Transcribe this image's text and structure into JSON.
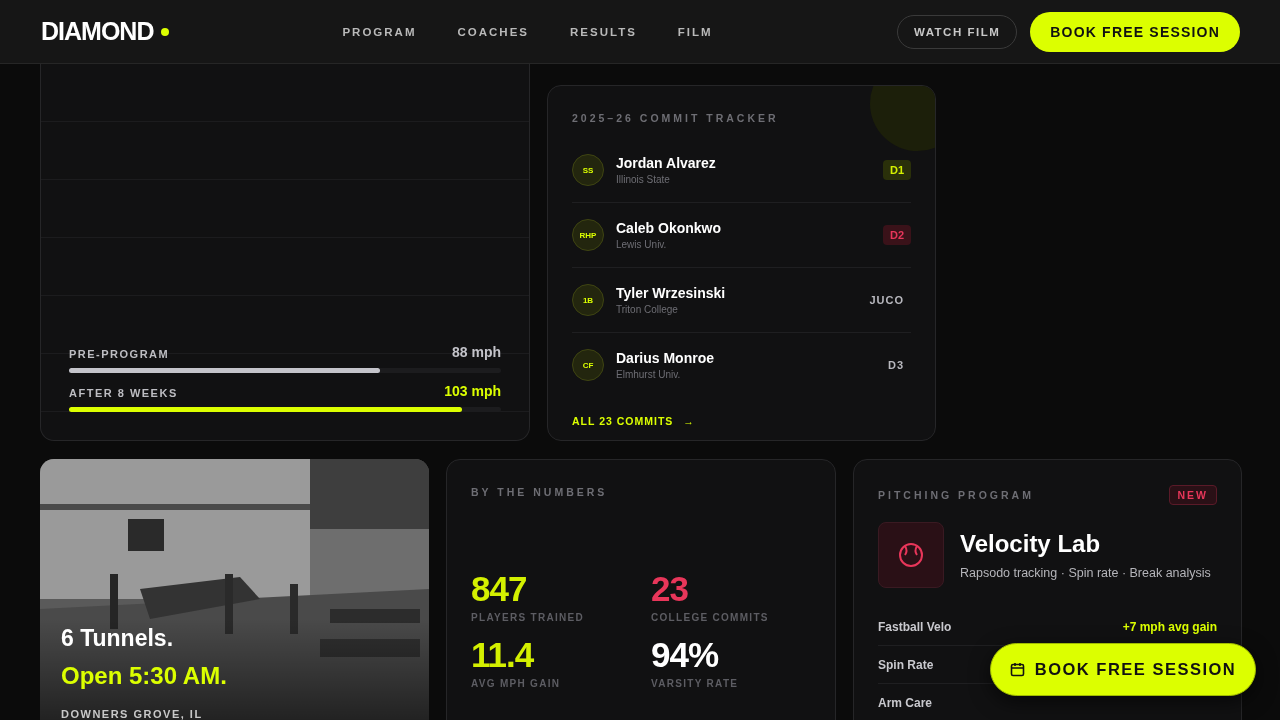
{
  "header": {
    "logo": "DIAMOND",
    "nav": [
      {
        "label": "PROGRAM"
      },
      {
        "label": "COACHES"
      },
      {
        "label": "RESULTS"
      },
      {
        "label": "FILM"
      }
    ],
    "secondary_button": "WATCH FILM",
    "primary_button": "BOOK FREE SESSION"
  },
  "velocity": {
    "bars": [
      {
        "label": "PRE-PROGRAM",
        "reading": "88 mph",
        "level": 0.72,
        "kind": "base"
      },
      {
        "label": "AFTER 8 WEEKS",
        "reading": "103 mph",
        "level": 0.91,
        "kind": "accent"
      }
    ]
  },
  "commits": {
    "title": "2025–26 COMMIT TRACKER",
    "players": [
      {
        "position": "SS",
        "name": "Jordan Alvarez",
        "school": "Illinois State",
        "division": "D1",
        "kind": "accent"
      },
      {
        "position": "RHP",
        "name": "Caleb Okonkwo",
        "school": "Lewis Univ.",
        "division": "D2",
        "kind": "alert"
      },
      {
        "position": "1B",
        "name": "Tyler Wrzesinski",
        "school": "Triton College",
        "division": "JUCO",
        "kind": "plain"
      },
      {
        "position": "CF",
        "name": "Darius Monroe",
        "school": "Elmhurst Univ.",
        "division": "D3",
        "kind": "plain"
      }
    ],
    "link": "ALL 23 COMMITS",
    "link_arrow": "→"
  },
  "facility": {
    "kind": "picture",
    "headline": "6 Tunnels.",
    "subline": "Open 5:30 AM.",
    "location": "DOWNERS GROVE, IL"
  },
  "numbers": {
    "title": "BY THE NUMBERS",
    "stats": [
      {
        "value": "847",
        "label": "PLAYERS TRAINED",
        "color": "#d4f000"
      },
      {
        "value": "23",
        "label": "COLLEGE COMMITS",
        "color": "#e8365a"
      },
      {
        "value": "11.4",
        "label": "AVG MPH GAIN",
        "color": "#d4f000"
      },
      {
        "value": "94%",
        "label": "VARSITY RATE",
        "color": "#ffffff"
      }
    ]
  },
  "pitching": {
    "title": "PITCHING PROGRAM",
    "badge": "NEW",
    "name": "Velocity Lab",
    "description": "Rapsodo tracking · Spin rate · Break analysis",
    "rows": [
      {
        "label": "Fastball Velo",
        "value": "+7 mph avg gain"
      },
      {
        "label": "Spin Rate"
      },
      {
        "label": "Arm Care"
      }
    ]
  },
  "floating_button": "BOOK FREE SESSION"
}
